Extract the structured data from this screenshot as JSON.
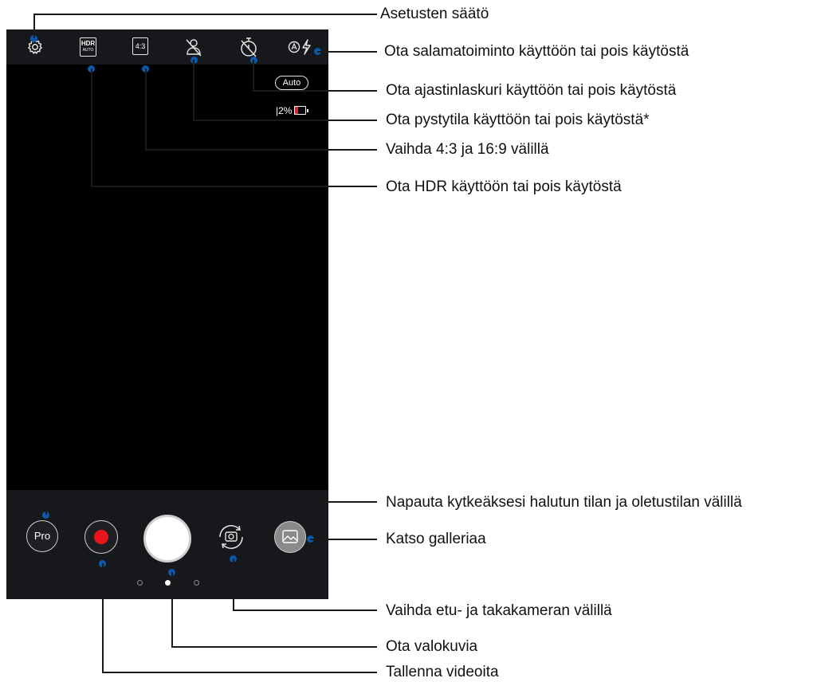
{
  "screen": {
    "top_icons": [
      "gear-icon",
      "hdr-auto-icon",
      "aspect-ratio-icon",
      "portrait-off-icon",
      "timer-off-icon",
      "flash-auto-icon"
    ],
    "hdr_top": "HDR",
    "hdr_bottom": "AUTO",
    "aspect": "4:3",
    "flash_mode": "Auto",
    "battery_text": "|2%",
    "pro_label": "Pro",
    "colors": {
      "bar": "#17181b",
      "record": "#e8151d",
      "pin": "#0b5aa9",
      "battery_low": "#e0242a"
    }
  },
  "callouts": {
    "settings": "Asetusten säätö",
    "flash": "Ota salamatoiminto käyttöön tai pois käytöstä",
    "timer": "Ota ajastinlaskuri käyttöön tai pois käytöstä",
    "portrait": "Ota pystytila käyttöön tai pois käytöstä*",
    "aspect": "Vaihda 4:3 ja 16:9 välillä",
    "hdr": "Ota HDR käyttöön tai pois käytöstä",
    "pro": "Napauta kytkeäksesi halutun tilan ja oletustilan välillä",
    "gallery": "Katso galleriaa",
    "switch_camera": "Vaihda etu- ja takakameran välillä",
    "photo": "Ota valokuvia",
    "video": "Tallenna videoita"
  }
}
